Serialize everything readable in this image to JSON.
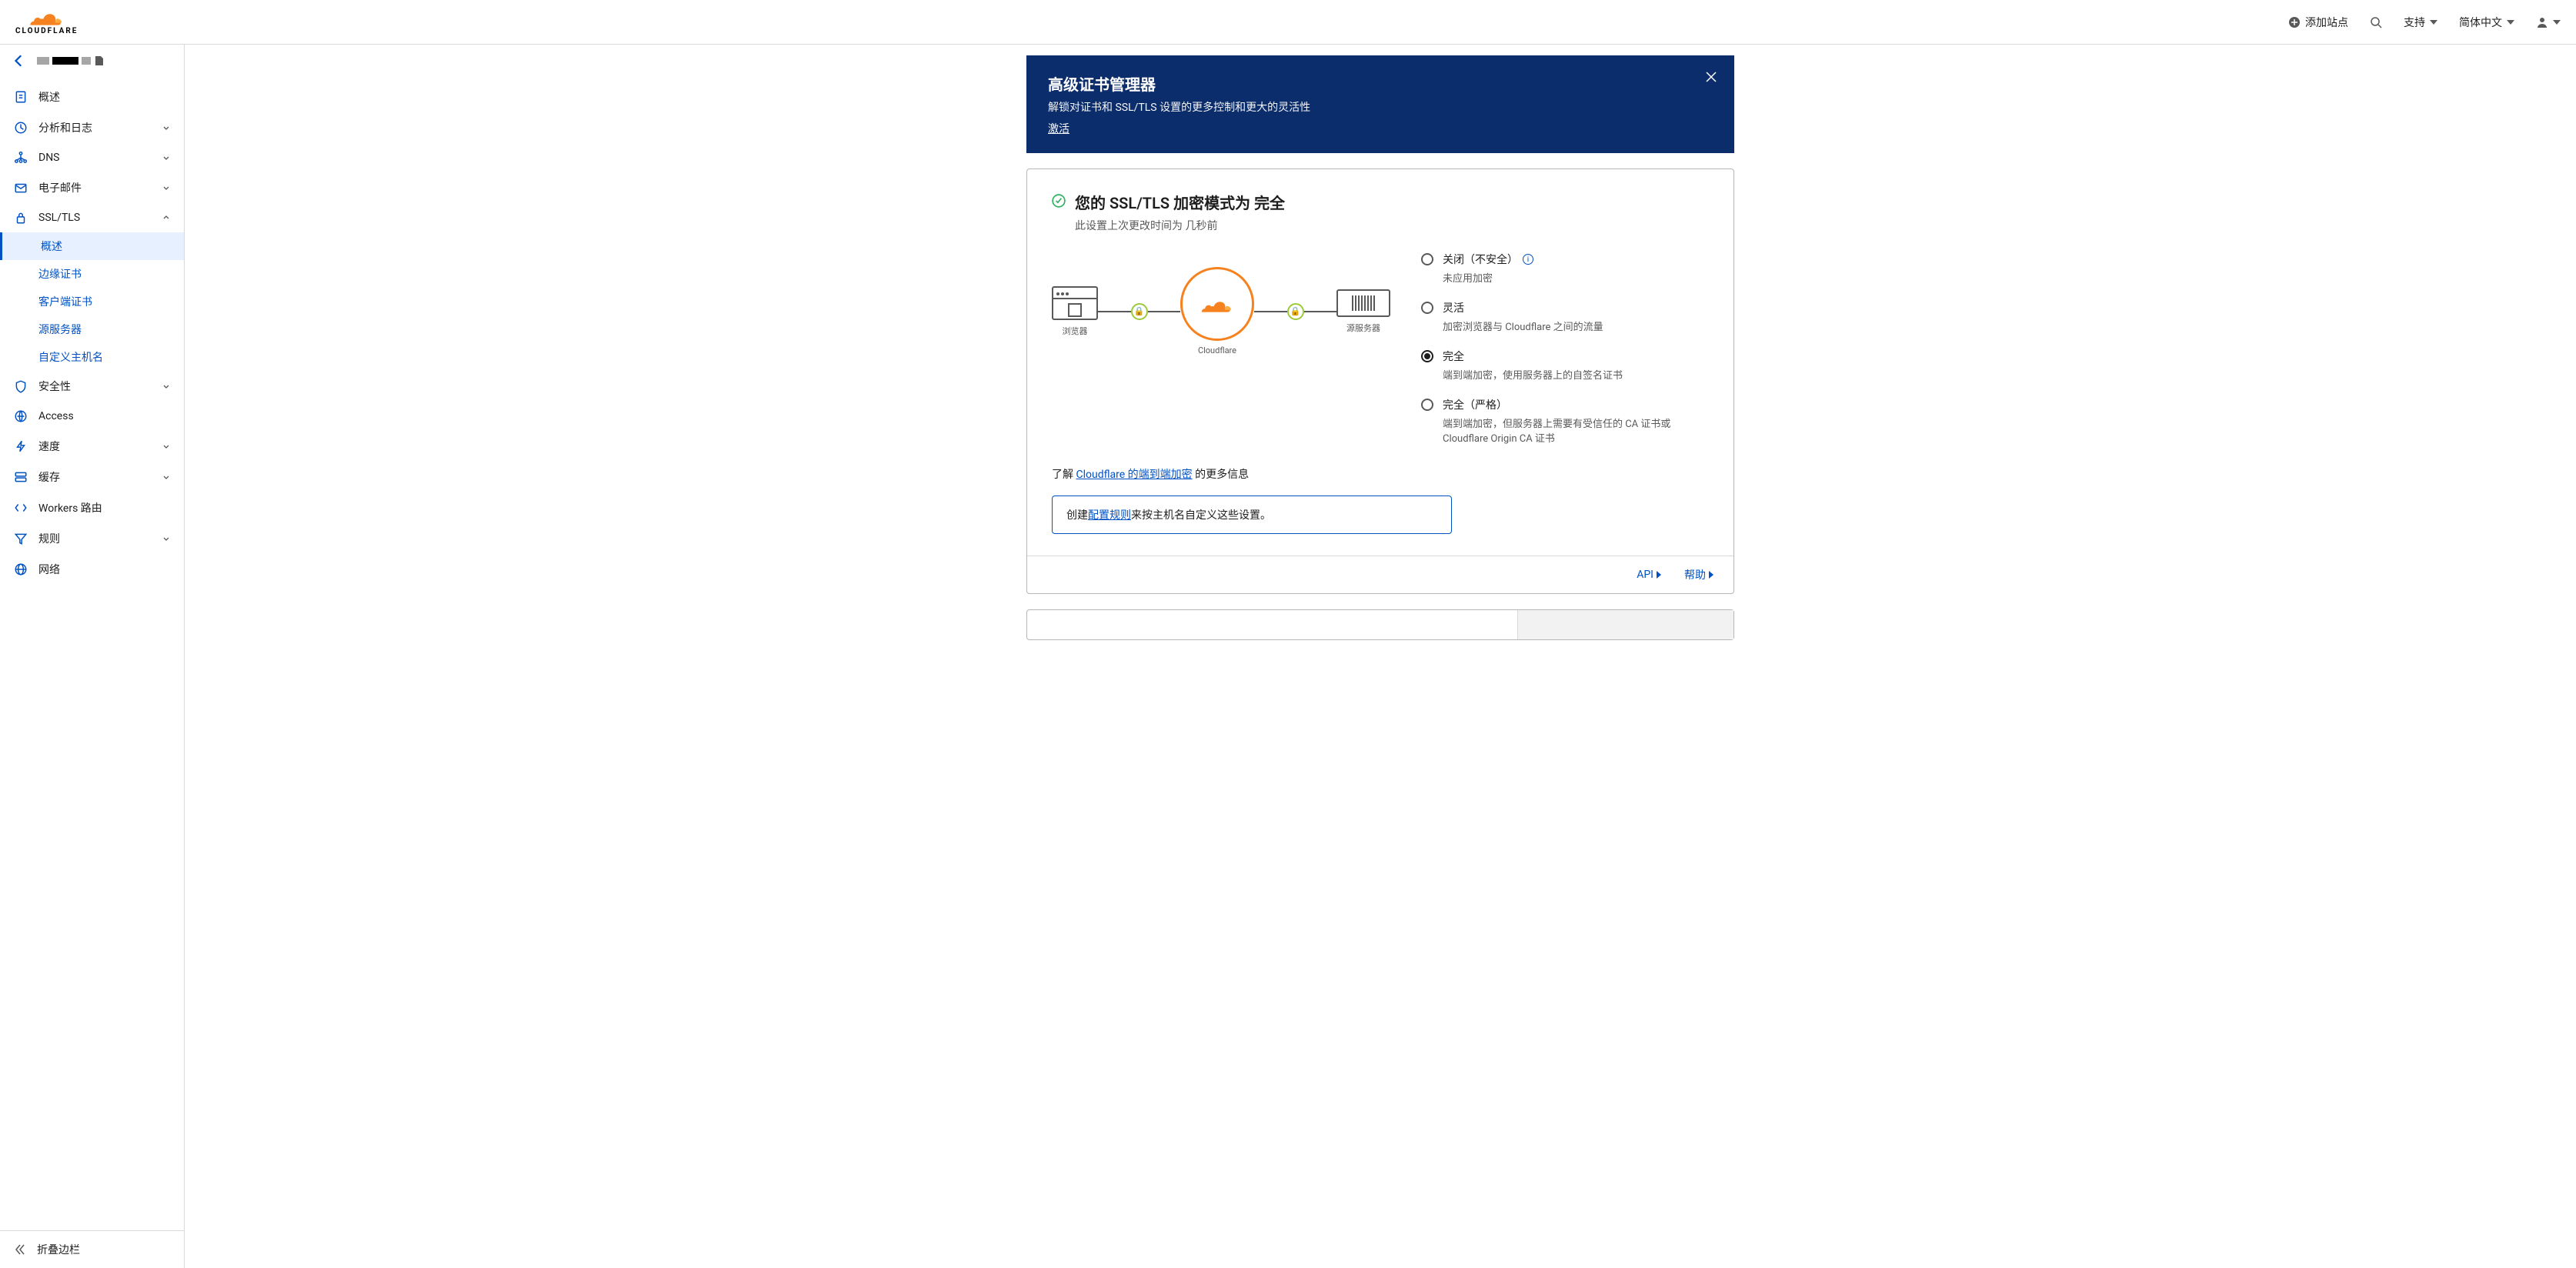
{
  "header": {
    "add_site": "添加站点",
    "support": "支持",
    "language": "简体中文"
  },
  "sidebar": {
    "items": [
      {
        "id": "overview",
        "label": "概述",
        "icon": "doc",
        "expandable": false
      },
      {
        "id": "analytics",
        "label": "分析和日志",
        "icon": "clock",
        "expandable": true
      },
      {
        "id": "dns",
        "label": "DNS",
        "icon": "network",
        "expandable": true
      },
      {
        "id": "email",
        "label": "电子邮件",
        "icon": "mail",
        "expandable": true
      },
      {
        "id": "ssl",
        "label": "SSL/TLS",
        "icon": "lock",
        "expandable": true,
        "expanded": true,
        "children": [
          {
            "id": "ssl-overview",
            "label": "概述",
            "active": true
          },
          {
            "id": "edge-certs",
            "label": "边缘证书"
          },
          {
            "id": "client-certs",
            "label": "客户端证书"
          },
          {
            "id": "origin-server",
            "label": "源服务器"
          },
          {
            "id": "custom-hostnames",
            "label": "自定义主机名"
          }
        ]
      },
      {
        "id": "security",
        "label": "安全性",
        "icon": "shield",
        "expandable": true
      },
      {
        "id": "access",
        "label": "Access",
        "icon": "access",
        "expandable": false
      },
      {
        "id": "speed",
        "label": "速度",
        "icon": "bolt",
        "expandable": true
      },
      {
        "id": "cache",
        "label": "缓存",
        "icon": "cache",
        "expandable": true
      },
      {
        "id": "workers",
        "label": "Workers 路由",
        "icon": "code",
        "expandable": false
      },
      {
        "id": "rules",
        "label": "规则",
        "icon": "funnel",
        "expandable": true
      },
      {
        "id": "network",
        "label": "网络",
        "icon": "globe",
        "expandable": false
      }
    ],
    "collapse": "折叠边栏"
  },
  "banner": {
    "title": "高级证书管理器",
    "desc": "解锁对证书和 SSL/TLS 设置的更多控制和更大的灵活性",
    "activate": "激活"
  },
  "ssl_card": {
    "title_prefix": "您的 SSL/TLS 加密模式为 ",
    "title_mode": "完全",
    "subtitle_prefix": "此设置上次更改时间为 ",
    "subtitle_time": "几秒前",
    "diagram": {
      "browser": "浏览器",
      "cloudflare": "Cloudflare",
      "origin": "源服务器"
    },
    "options": [
      {
        "id": "off",
        "title": "关闭（不安全）",
        "desc": "未应用加密",
        "info": true
      },
      {
        "id": "flexible",
        "title": "灵活",
        "desc": "加密浏览器与 Cloudflare 之间的流量"
      },
      {
        "id": "full",
        "title": "完全",
        "desc": "端到端加密，使用服务器上的自签名证书",
        "checked": true
      },
      {
        "id": "strict",
        "title": "完全（严格）",
        "desc": "端到端加密，但服务器上需要有受信任的 CA 证书或 Cloudflare Origin CA 证书"
      }
    ],
    "learn_prefix": "了解 ",
    "learn_link": "Cloudflare 的端到端加密",
    "learn_suffix": " 的更多信息",
    "hint_prefix": "创建",
    "hint_link": "配置规则",
    "hint_suffix": "来按主机名自定义这些设置。",
    "footer_api": "API",
    "footer_help": "帮助"
  }
}
